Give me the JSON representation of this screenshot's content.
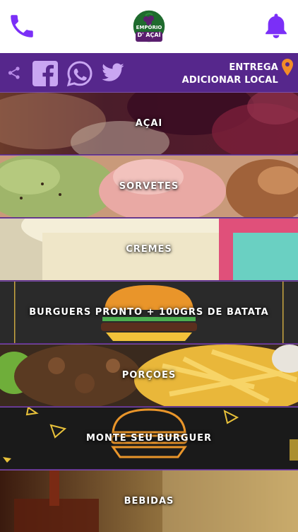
{
  "header": {
    "logo_line1": "EMPÓRIO",
    "logo_line2": "D' AÇAÍ",
    "icons": [
      "phone-icon",
      "logo-icon",
      "bell-icon"
    ]
  },
  "social": {
    "icons": [
      "share-icon",
      "facebook-icon",
      "whatsapp-icon",
      "twitter-icon"
    ],
    "delivery_label": "ENTREGA",
    "add_location_label": "ADICIONAR LOCAL"
  },
  "categories": [
    {
      "label": "AÇAI"
    },
    {
      "label": "SORVETES"
    },
    {
      "label": "CREMES"
    },
    {
      "label": "BURGUERS PRONTO + 100GRS DE BATATA"
    },
    {
      "label": "PORÇOES"
    },
    {
      "label": "MONTE SEU BURGUER"
    },
    {
      "label": "BEBIDAS"
    }
  ],
  "colors": {
    "brand_purple": "#7b2ff7",
    "bar_purple": "#56278c",
    "divider": "#7a4fa8",
    "pin_orange": "#f28c28"
  }
}
